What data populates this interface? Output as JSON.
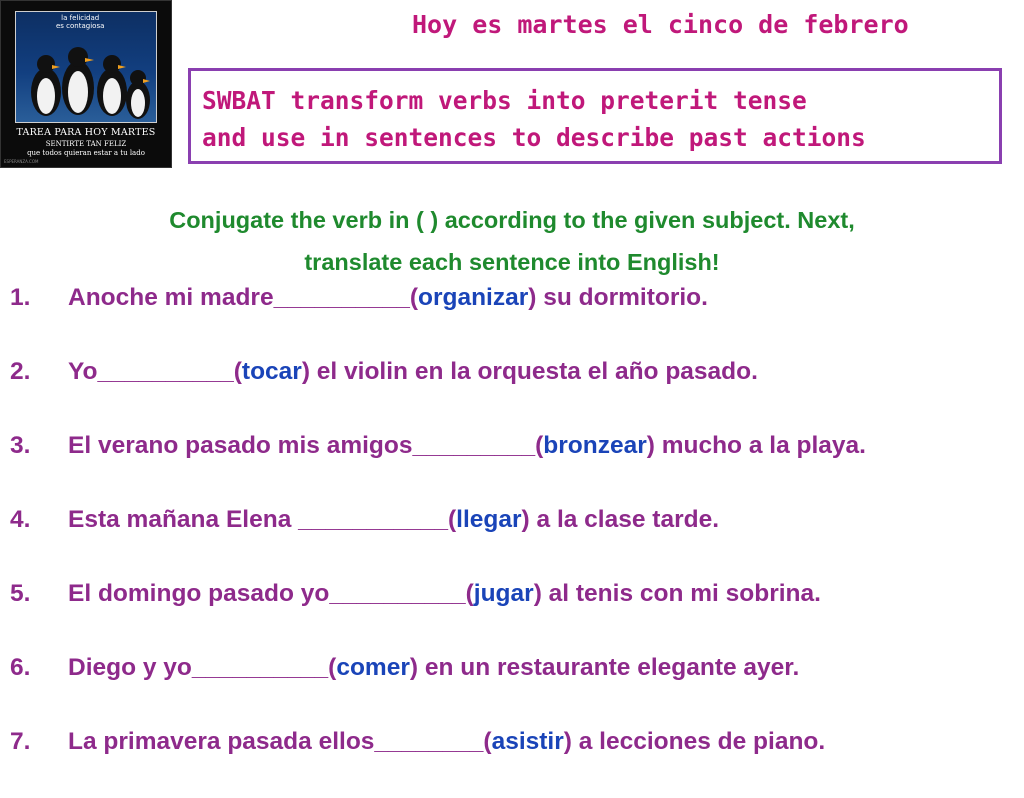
{
  "poster": {
    "badge_line1": "la felicidad",
    "badge_line2": "es contagiosa",
    "title": "TAREA PARA HOY MARTES",
    "subtitle1": "SENTIRTE TAN FELIZ",
    "subtitle2": "que todos quieran estar a tu lado",
    "credit": "ESPERANZA.COM"
  },
  "date": "Hoy es martes el cinco de febrero",
  "objective": {
    "line1": "SWBAT transform verbs into preterit tense",
    "line2": "and use in sentences to describe past actions"
  },
  "instructions": {
    "line1": "Conjugate the verb in ( ) according to the given subject. Next,",
    "line2": "translate each sentence into English!"
  },
  "colors": {
    "date_text": "#c0187a",
    "objective_border": "#8a3fb0",
    "instructions_text": "#1f8a2e",
    "sentence_text": "#8e2a8b",
    "verb_text": "#1a44b8"
  },
  "sentences": [
    {
      "number": "1.",
      "before": "Anoche mi madre__________(",
      "verb": "organizar",
      "after": ") su dormitorio."
    },
    {
      "number": "2.",
      "before": "Yo__________(",
      "verb": "tocar",
      "after": ") el violin en la orquesta el año pasado."
    },
    {
      "number": "3.",
      "before": "El verano pasado mis amigos_________(",
      "verb": "bronzear",
      "after": ") mucho a la playa."
    },
    {
      "number": "4.",
      "before": "Esta mañana Elena ___________(",
      "verb": "llegar",
      "after": ") a la clase tarde."
    },
    {
      "number": "5.",
      "before": "El domingo pasado yo__________(",
      "verb": "jugar",
      "after": ") al tenis con mi sobrina."
    },
    {
      "number": "6.",
      "before": "Diego y yo__________(",
      "verb": "comer",
      "after": ") en un restaurante elegante ayer."
    },
    {
      "number": "7.",
      "before": "La primavera pasada ellos________(",
      "verb": "asistir",
      "after": ") a lecciones de piano."
    }
  ]
}
